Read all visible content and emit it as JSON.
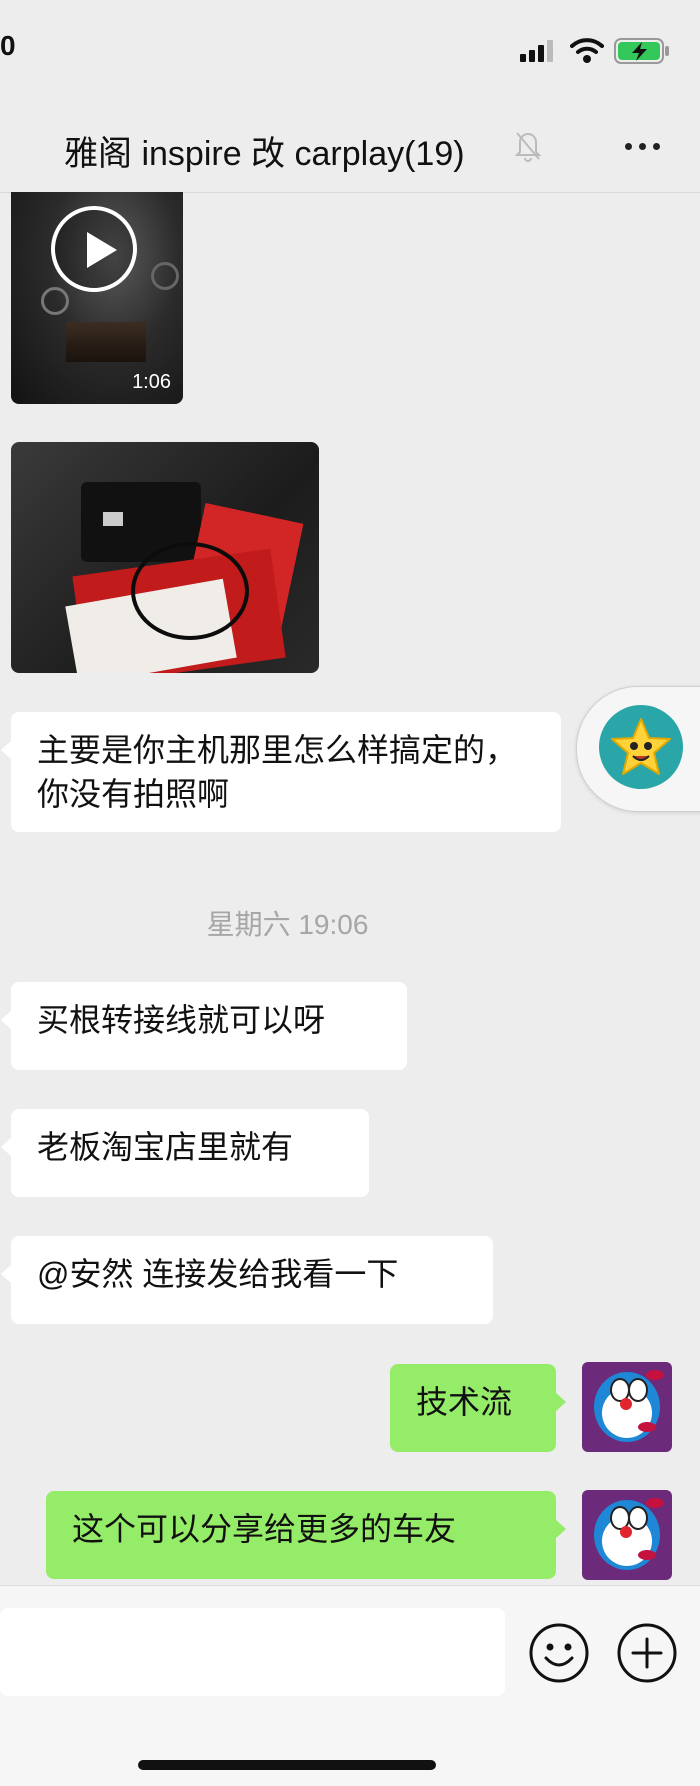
{
  "status_bar": {
    "time": "0"
  },
  "header": {
    "title": "雅阁 inspire 改 carplay(19)"
  },
  "messages": {
    "video_duration": "1:06",
    "m1": "主要是你主机那里怎么样搞定的，你没有拍照啊",
    "timestamp": "星期六 19:06",
    "m2": "买根转接线就可以呀",
    "m3": "老板淘宝店里就有",
    "m4": "@安然 连接发给我看一下",
    "m5": "技术流",
    "m6": "这个可以分享给更多的车友"
  },
  "input": {
    "value": ""
  },
  "colors": {
    "self_bubble": "#95ec69",
    "background": "#ededed",
    "other_bubble": "#ffffff"
  }
}
